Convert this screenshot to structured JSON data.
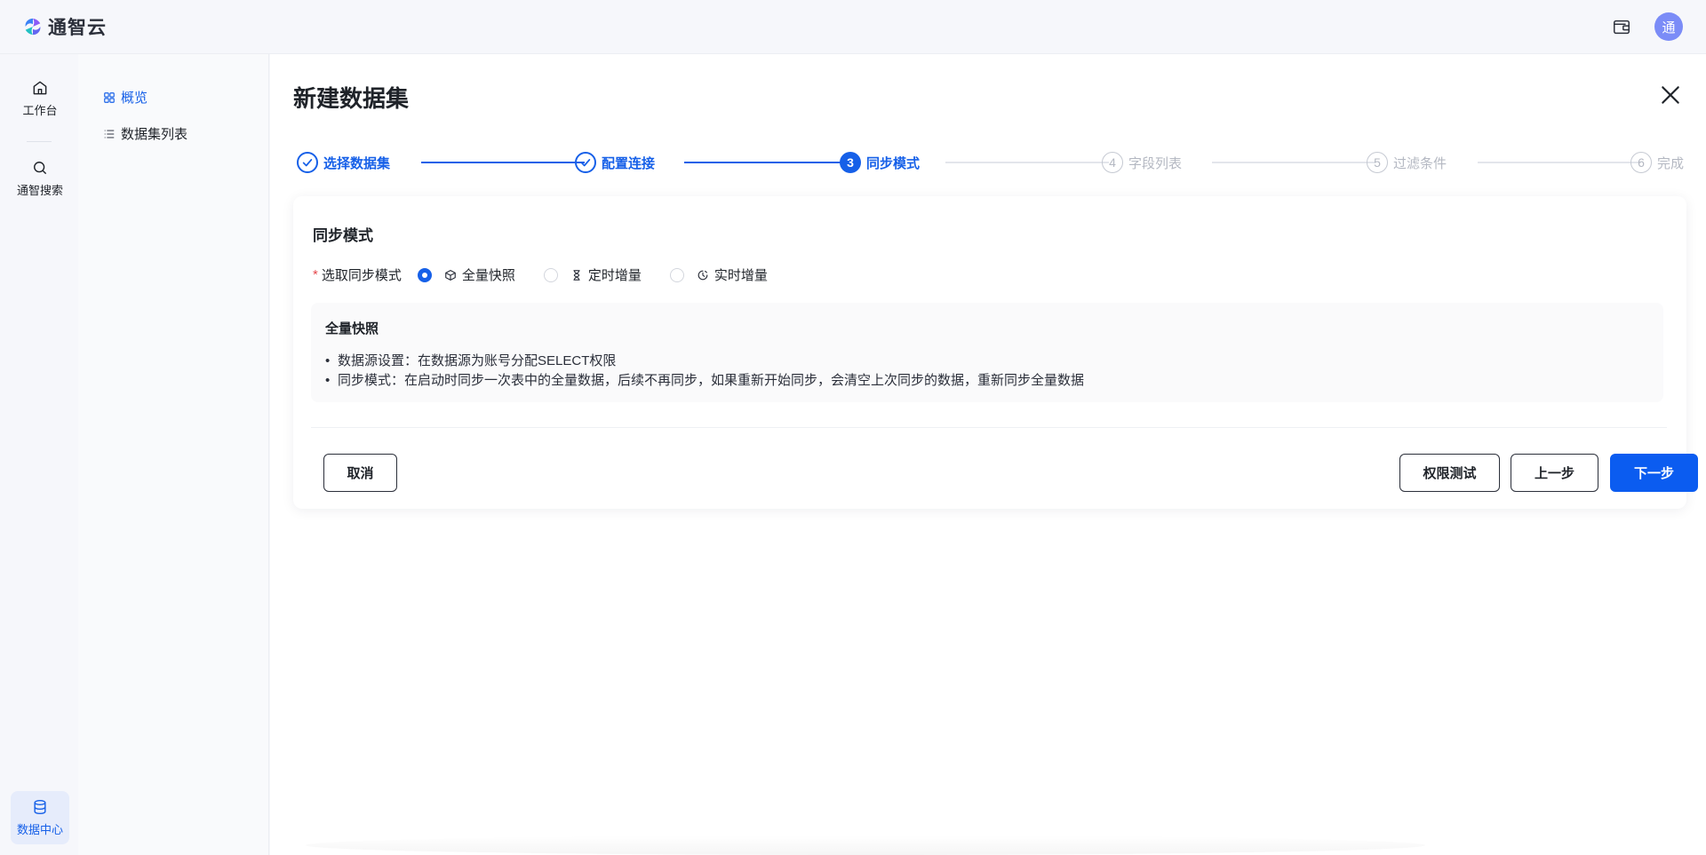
{
  "brand": {
    "name": "通智云"
  },
  "user": {
    "avatar_text": "通"
  },
  "rail": {
    "items": [
      {
        "label": "工作台",
        "icon": "home-icon"
      },
      {
        "label": "通智搜索",
        "icon": "search-icon"
      },
      {
        "label": "数据中心",
        "icon": "database-icon"
      }
    ]
  },
  "submenu": {
    "items": [
      {
        "label": "概览",
        "icon": "grid-icon"
      },
      {
        "label": "数据集列表",
        "icon": "list-icon"
      }
    ]
  },
  "page": {
    "title": "新建数据集"
  },
  "steps": [
    {
      "num": "1",
      "label": "选择数据集",
      "state": "done"
    },
    {
      "num": "2",
      "label": "配置连接",
      "state": "done"
    },
    {
      "num": "3",
      "label": "同步模式",
      "state": "current"
    },
    {
      "num": "4",
      "label": "字段列表",
      "state": "todo"
    },
    {
      "num": "5",
      "label": "过滤条件",
      "state": "todo"
    },
    {
      "num": "6",
      "label": "完成",
      "state": "todo"
    }
  ],
  "card": {
    "title": "同步模式",
    "required_mark": "*",
    "mode_label": "选取同步模式",
    "options": [
      {
        "label": "全量快照",
        "icon": "cube-icon",
        "checked": true
      },
      {
        "label": "定时增量",
        "icon": "hourglass-icon",
        "checked": false
      },
      {
        "label": "实时增量",
        "icon": "clock-icon",
        "checked": false
      }
    ],
    "info": {
      "title": "全量快照",
      "lines": [
        "数据源设置：在数据源为账号分配SELECT权限",
        "同步模式：在启动时同步一次表中的全量数据，后续不再同步，如果重新开始同步，会清空上次同步的数据，重新同步全量数据"
      ]
    },
    "buttons": {
      "cancel": "取消",
      "permission_test": "权限测试",
      "prev": "上一步",
      "next": "下一步"
    }
  },
  "colors": {
    "accent": "#1660e8",
    "primary_button": "#0b5cf0",
    "required": "#e5484d"
  }
}
